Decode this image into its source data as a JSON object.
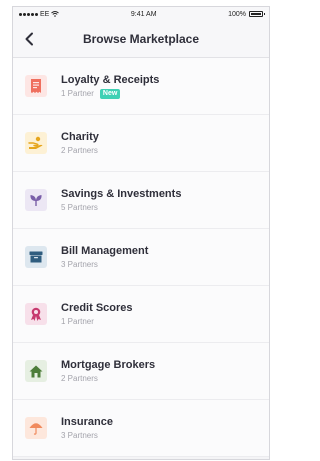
{
  "status_bar": {
    "carrier": "EE",
    "time": "9:41 AM",
    "battery": "100%"
  },
  "nav": {
    "title": "Browse Marketplace",
    "back_icon": "chevron-left-icon"
  },
  "items": [
    {
      "title": "Loyalty & Receipts",
      "subtitle": "1 Partner",
      "badge": "New",
      "icon": "receipt-icon",
      "bg": "#fde6e4",
      "fg": "#ef6f5e"
    },
    {
      "title": "Charity",
      "subtitle": "2 Partners",
      "icon": "charity-hands-icon",
      "bg": "#fdf1d5",
      "fg": "#e6a51c"
    },
    {
      "title": "Savings & Investments",
      "subtitle": "5 Partners",
      "icon": "plant-icon",
      "bg": "#ece7f4",
      "fg": "#7a5fa8"
    },
    {
      "title": "Bill Management",
      "subtitle": "3 Partners",
      "icon": "archive-box-icon",
      "bg": "#dde7ef",
      "fg": "#2f5d7f"
    },
    {
      "title": "Credit Scores",
      "subtitle": "1 Partner",
      "icon": "award-ribbon-icon",
      "bg": "#f7e0ea",
      "fg": "#c73a6f"
    },
    {
      "title": "Mortgage Brokers",
      "subtitle": "2 Partners",
      "icon": "house-icon",
      "bg": "#e6efe2",
      "fg": "#4d7d3a"
    },
    {
      "title": "Insurance",
      "subtitle": "3 Partners",
      "icon": "umbrella-icon",
      "bg": "#fde7dc",
      "fg": "#f08a5d"
    }
  ]
}
